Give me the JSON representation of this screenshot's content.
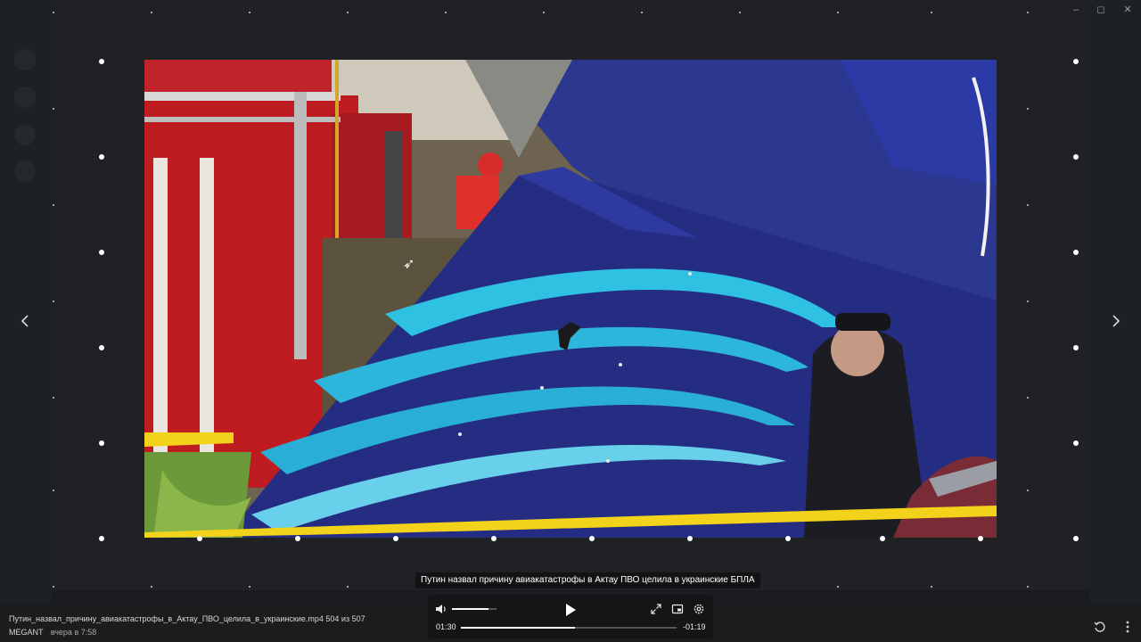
{
  "caption": "Путин назвал причину авиакатастрофы в Актау  ПВО целила в украинские БПЛА",
  "file": {
    "name": "Путин_назвал_причину_авиакатастрофы_в_Актау_ПВО_целила_в_украинские.mp4",
    "position": "504 из 507",
    "sender": "MEGANT",
    "date": "вчера в 7:58"
  },
  "player": {
    "current_time": "01:30",
    "remaining_time": "-01:19",
    "progress": 0.53,
    "volume": 0.82,
    "icons": {
      "volume": "volume-icon",
      "play": "play-icon",
      "fullscreen": "fullscreen-icon",
      "pip": "picture-in-picture-icon",
      "settings": "settings-icon"
    }
  },
  "nav": {
    "prev_icon": "chevron-left-icon",
    "next_icon": "chevron-right-icon"
  },
  "window_controls": {
    "minimize": "–",
    "maximize": "◻",
    "close": "✕"
  },
  "bottom_icons": {
    "rotate": "rotate-icon",
    "more": "more-vertical-icon"
  },
  "colors": {
    "accent_yellow": "#f2d21a",
    "fuselage": "#2b338a",
    "stripe": "#2fc2e3"
  }
}
